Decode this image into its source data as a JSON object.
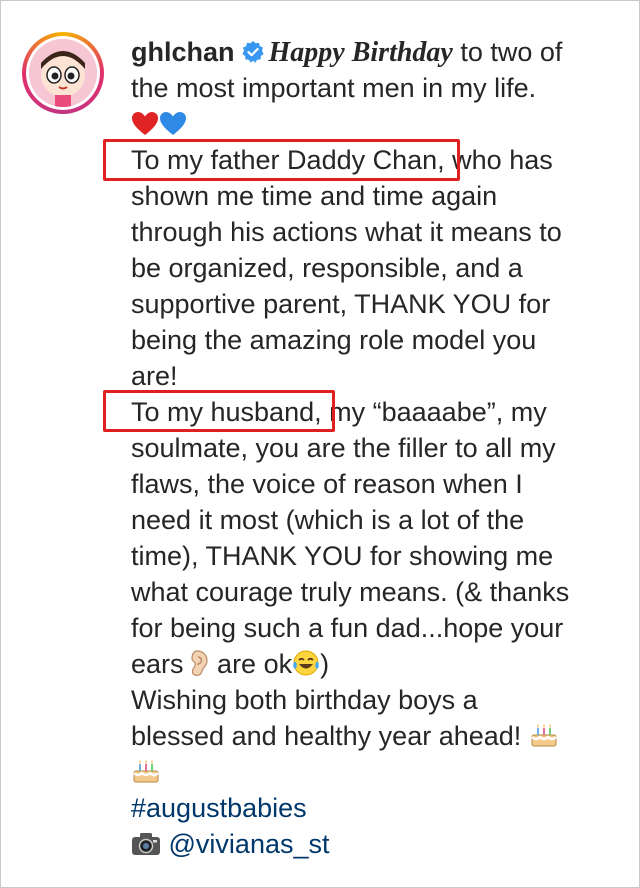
{
  "post": {
    "username": "ghlchan",
    "caption": {
      "opening_styled": "Happy Birthday",
      "line_1_rest": "to two of",
      "line_2": "the most important men in my life.",
      "line_4_highlight": "To my father Daddy Chan,",
      "line_4_rest": "who has",
      "line_5": "shown me time and time again",
      "line_6": "through his actions what it means to",
      "line_7": "be organized, responsible, and a",
      "line_8": "supportive parent, THANK YOU for",
      "line_9": "being the amazing role model you",
      "line_10": "are!",
      "line_11_highlight": "To my husband,",
      "line_11_rest": "my “baaaabe”, my",
      "line_12": "soulmate, you are the filler to all my",
      "line_13": "flaws, the voice of reason when I",
      "line_14": "need it most (which is a lot of the",
      "line_15": "time), THANK YOU for showing me",
      "line_16": "what courage truly means. (& thanks",
      "line_17": "for being such a fun dad...hope your",
      "line_18_a": "ears",
      "line_18_b": "are ok",
      "line_18_c": ")",
      "line_19": "Wishing both birthday boys a",
      "line_20": "blessed and healthy year ahead!",
      "hashtag": "#augustbabies",
      "photo_credit": "@vivianas_st"
    },
    "emojis": [
      "red-heart",
      "blue-heart",
      "ear",
      "tears-of-joy",
      "birthday-cake",
      "birthday-cake",
      "camera"
    ]
  },
  "colors": {
    "highlight_box": "#e02020",
    "link": "#00376b",
    "verified": "#3897f0"
  }
}
